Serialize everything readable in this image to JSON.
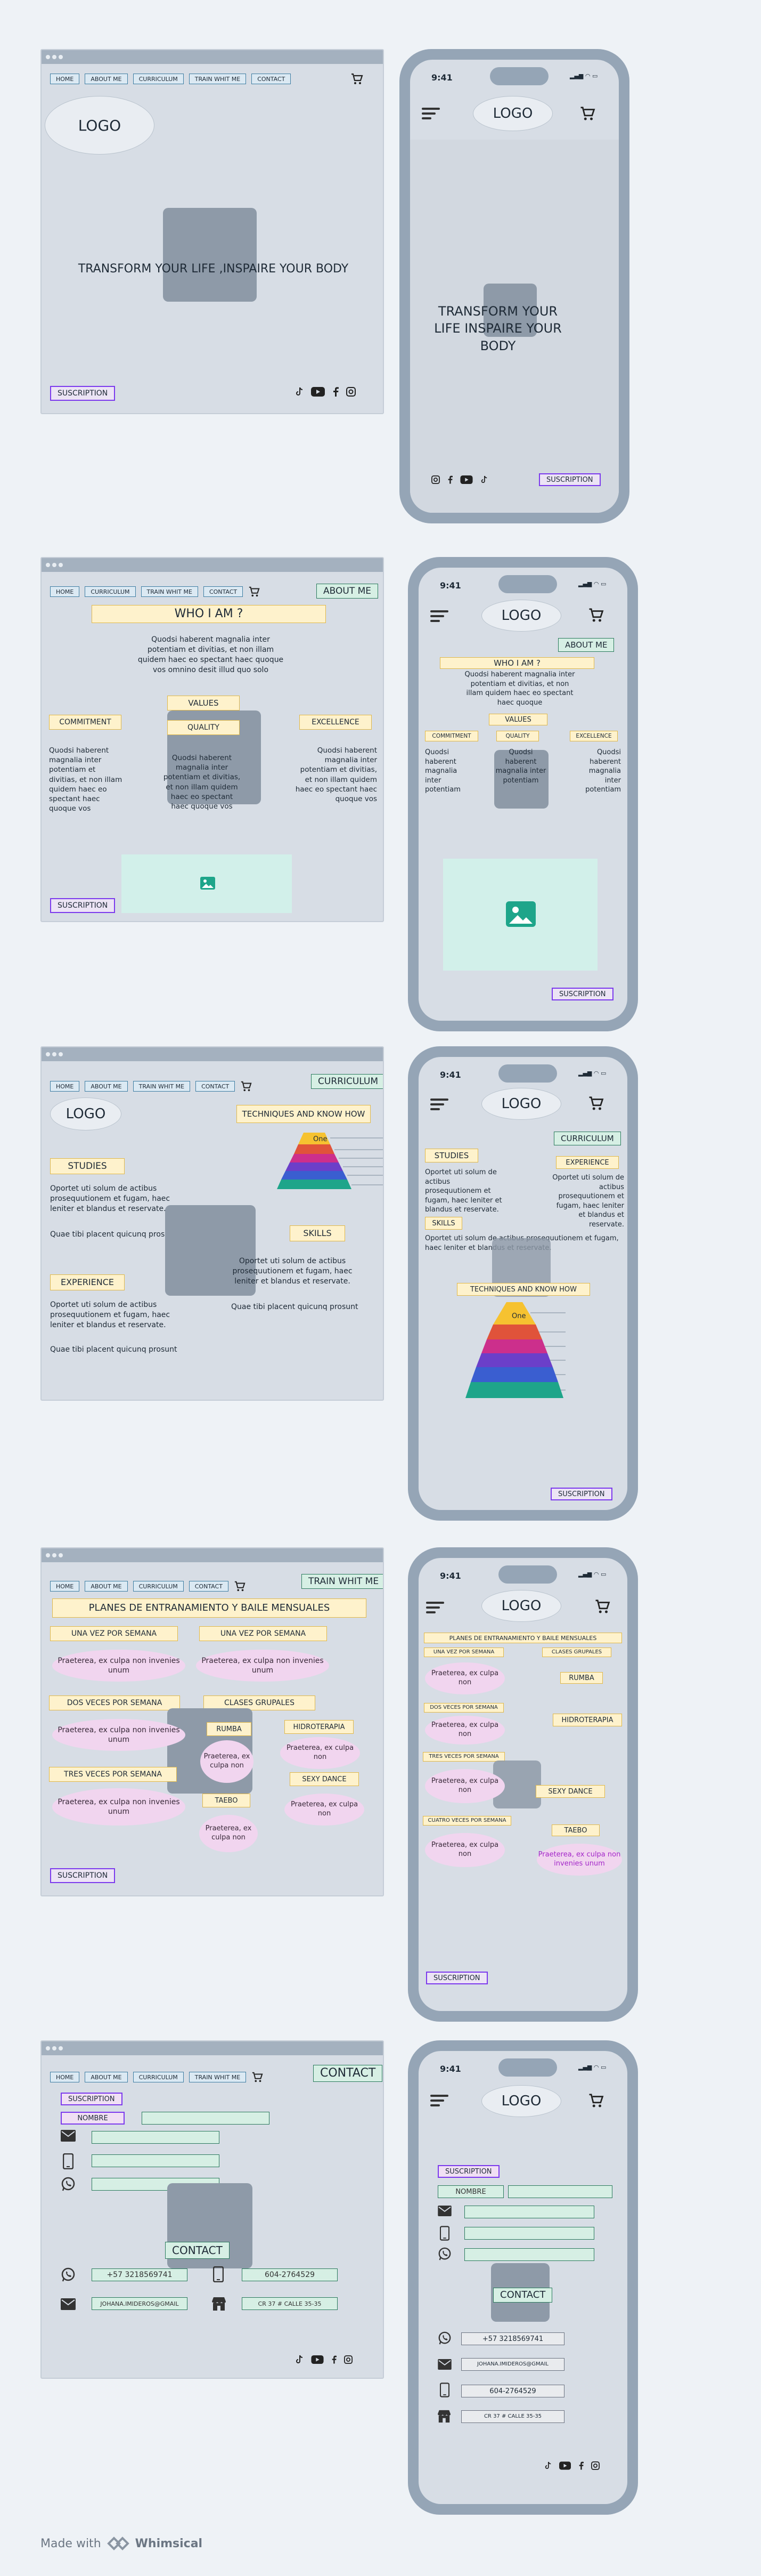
{
  "nav": {
    "home": "HOME",
    "about": "ABOUT ME",
    "curriculum": "CURRICULUM",
    "train": "TRAIN WHIT ME",
    "contact": "CONTACT"
  },
  "common": {
    "logo": "LOGO",
    "suscription": "SUSCRIPTION",
    "time": "9:41"
  },
  "home": {
    "headline_desktop": "TRANSFORM YOUR LIFE ,INSPAIRE YOUR BODY",
    "headline_mobile": "TRANSFORM YOUR LIFE INSPAIRE YOUR BODY"
  },
  "about": {
    "tag": "ABOUT ME",
    "title": "WHO I AM ?",
    "intro": "Quodsi haberent magnalia inter potentiam et divitias, et non illam quidem haec eo spectant haec quoque vos omnino desit illud quo solo",
    "intro_mobile": "Quodsi haberent magnalia inter potentiam et divitias, et non illam quidem haec eo spectant haec quoque",
    "values": "VALUES",
    "commitment": "COMMITMENT",
    "quality": "QUALITY",
    "excellence": "EXCELLENCE",
    "col_text": "Quodsi haberent magnalia inter potentiam et divitias, et non illam quidem haec eo spectant haec quoque vos",
    "col_text_mobile": "Quodsi haberent magnalia inter potentiam"
  },
  "curriculum": {
    "tag": "CURRICULUM",
    "techniques": "TECHNIQUES AND KNOW HOW",
    "studies": "STUDIES",
    "experience": "EXPERIENCE",
    "skills": "SKILLS",
    "text1": "Oportet uti solum de actibus prosequutionem et fugam, haec leniter et blandus et reservate.",
    "text2": "Quae tibi placent quicunq prosunt",
    "pyramid_label": "One"
  },
  "train": {
    "tag": "TRAIN WHIT ME",
    "title": "PLANES DE ENTRANAMIENTO Y BAILE MENSUALES",
    "once": "UNA VEZ POR SEMANA",
    "twice": "DOS VECES POR SEMANA",
    "thrice": "TRES VECES POR SEMANA",
    "four": "CUATRO VECES POR SEMANA",
    "group": "CLASES GRUPALES",
    "rumba": "RUMBA",
    "hidro": "HIDROTERAPIA",
    "sexy": "SEXY DANCE",
    "taebo": "TAEBO",
    "blob": "Praeterea, ex culpa non invenies unum",
    "blob_short": "Praeterea, ex culpa non"
  },
  "contact": {
    "tag": "CONTACT",
    "name_label": "NOMBRE",
    "button": "CONTACT",
    "phone1": "+57 3218569741",
    "phone2": "604-2764529",
    "email": "JOHANA.IMIDEROS@GMAIL",
    "address": "CR 37 # CALLE 35-35"
  },
  "footer": {
    "made": "Made with",
    "brand": "Whimsical"
  }
}
